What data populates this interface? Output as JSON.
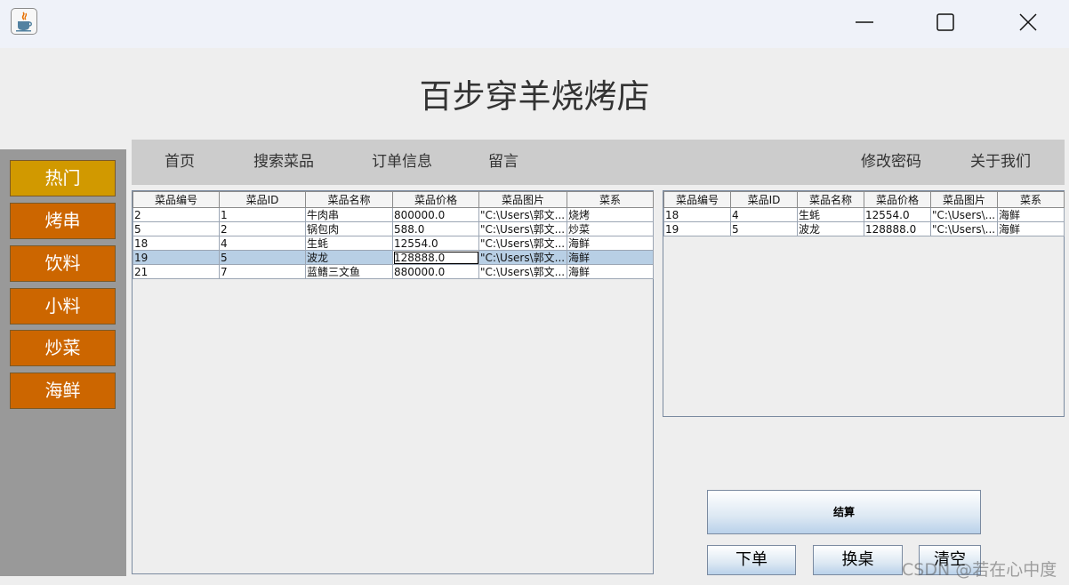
{
  "window": {
    "icon": "java-icon",
    "controls": [
      "minimize-icon",
      "maximize-icon",
      "close-icon"
    ]
  },
  "store_title": "百步穿羊烧烤店",
  "sidebar": {
    "items": [
      {
        "label": "热门",
        "color": "#d19900"
      },
      {
        "label": "烤串",
        "color": "#cc6600"
      },
      {
        "label": "饮料",
        "color": "#cc6600"
      },
      {
        "label": "小料",
        "color": "#cc6600"
      },
      {
        "label": "炒菜",
        "color": "#cc6600"
      },
      {
        "label": "海鲜",
        "color": "#cc6600"
      }
    ]
  },
  "nav": {
    "home": "首页",
    "search": "搜索菜品",
    "orders": "订单信息",
    "messages": "留言",
    "change_password": "修改密码",
    "about": "关于我们"
  },
  "menu_table": {
    "columns": [
      "菜品编号",
      "菜品ID",
      "菜品名称",
      "菜品价格",
      "菜品图片",
      "菜系"
    ],
    "rows": [
      [
        "2",
        "1",
        "牛肉串",
        "800000.0",
        "\"C:\\Users\\郭文...",
        "烧烤"
      ],
      [
        "5",
        "2",
        "锅包肉",
        "588.0",
        "\"C:\\Users\\郭文...",
        "炒菜"
      ],
      [
        "18",
        "4",
        "生蚝",
        "12554.0",
        "\"C:\\Users\\郭文...",
        "海鲜"
      ],
      [
        "19",
        "5",
        "波龙",
        "128888.0",
        "\"C:\\Users\\郭文...",
        "海鲜"
      ],
      [
        "21",
        "7",
        "蓝鳍三文鱼",
        "880000.0",
        "\"C:\\Users\\郭文...",
        "海鲜"
      ]
    ],
    "selected_row": 3
  },
  "cart_table": {
    "columns": [
      "菜品编号",
      "菜品ID",
      "菜品名称",
      "菜品价格",
      "菜品图片",
      "菜系"
    ],
    "rows": [
      [
        "18",
        "4",
        "生蚝",
        "12554.0",
        "\"C:\\Users\\...",
        "海鲜"
      ],
      [
        "19",
        "5",
        "波龙",
        "128888.0",
        "\"C:\\Users\\...",
        "海鲜"
      ]
    ]
  },
  "actions": {
    "checkout": "结算",
    "place_order": "下单",
    "change_table": "换桌",
    "clear": "清空"
  },
  "watermark": "CSDN @若在心中度"
}
